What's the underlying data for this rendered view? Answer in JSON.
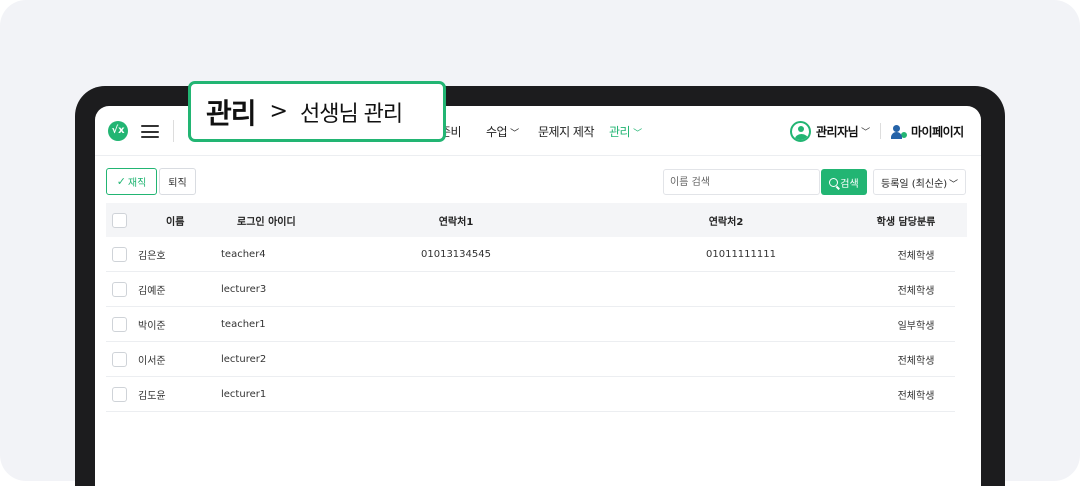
{
  "breadcrumb": {
    "section": "관리",
    "separator": ">",
    "page": "선생님 관리"
  },
  "nav": {
    "items": [
      {
        "label": "준비",
        "active": false,
        "dropdown": false
      },
      {
        "label": "수업",
        "active": false,
        "dropdown": true
      },
      {
        "label": "문제지 제작",
        "active": false,
        "dropdown": false
      },
      {
        "label": "관리",
        "active": true,
        "dropdown": true
      }
    ],
    "user_name": "관리자님",
    "mypage_label": "마이페이지"
  },
  "toolbar": {
    "filter_active_label": "재직",
    "filter_retired_label": "퇴직",
    "search_placeholder": "이름 검색",
    "search_button_label": "검색",
    "sort_value": "등록일 (최신순)"
  },
  "table": {
    "headers": {
      "name": "이름",
      "login_id": "로그인 아이디",
      "phone1": "연락처1",
      "phone2": "연락처2",
      "category": "학생 담당분류"
    },
    "rows": [
      {
        "name": "김은호",
        "login_id": "teacher4",
        "phone1": "01013134545",
        "phone2": "01011111111",
        "category": "전체학생"
      },
      {
        "name": "김예준",
        "login_id": "lecturer3",
        "phone1": "",
        "phone2": "",
        "category": "전체학생"
      },
      {
        "name": "박이준",
        "login_id": "teacher1",
        "phone1": "",
        "phone2": "",
        "category": "일부학생"
      },
      {
        "name": "이서준",
        "login_id": "lecturer2",
        "phone1": "",
        "phone2": "",
        "category": "전체학생"
      },
      {
        "name": "김도윤",
        "login_id": "lecturer1",
        "phone1": "",
        "phone2": "",
        "category": "전체학생"
      }
    ]
  },
  "colors": {
    "accent": "#22b573",
    "backdrop": "#f2f3f7",
    "device_frame": "#1c1c1e"
  }
}
